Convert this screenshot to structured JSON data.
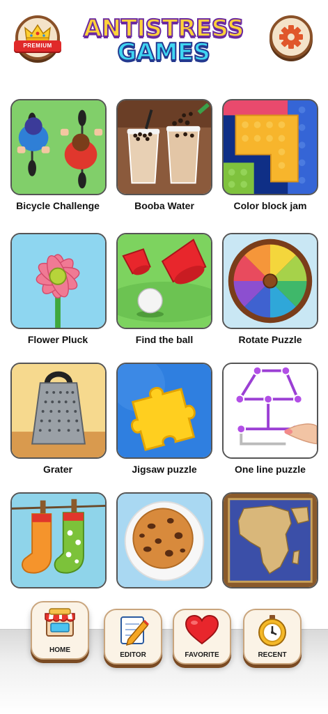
{
  "header": {
    "premium_badge": "PREMIUM",
    "title_line1": "ANTISTRESS",
    "title_line2": "GAMES",
    "settings_icon": "gear-icon"
  },
  "colors": {
    "title_yellow": "#ffd23a",
    "title_cyan": "#3fd6f2",
    "button_brown": "#8a5128",
    "button_cream": "#f4e3c9"
  },
  "games": [
    {
      "label": "Bicycle Challenge",
      "icon": "bicycle-icon"
    },
    {
      "label": "Booba Water",
      "icon": "bubble-tea-icon"
    },
    {
      "label": "Color block jam",
      "icon": "color-blocks-icon"
    },
    {
      "label": "Flower Pluck",
      "icon": "flower-icon"
    },
    {
      "label": "Find the ball",
      "icon": "cups-ball-icon"
    },
    {
      "label": "Rotate Puzzle",
      "icon": "color-wheel-icon"
    },
    {
      "label": "Grater",
      "icon": "grater-icon"
    },
    {
      "label": "Jigsaw puzzle",
      "icon": "jigsaw-icon"
    },
    {
      "label": "One line puzzle",
      "icon": "one-line-icon"
    },
    {
      "label": "",
      "icon": "socks-icon"
    },
    {
      "label": "",
      "icon": "cookie-icon"
    },
    {
      "label": "",
      "icon": "world-map-icon"
    }
  ],
  "nav": [
    {
      "label": "HOME",
      "icon": "shop-icon"
    },
    {
      "label": "EDITOR",
      "icon": "editor-icon"
    },
    {
      "label": "FAVORITE",
      "icon": "heart-icon"
    },
    {
      "label": "RECENT",
      "icon": "stopwatch-icon"
    }
  ]
}
